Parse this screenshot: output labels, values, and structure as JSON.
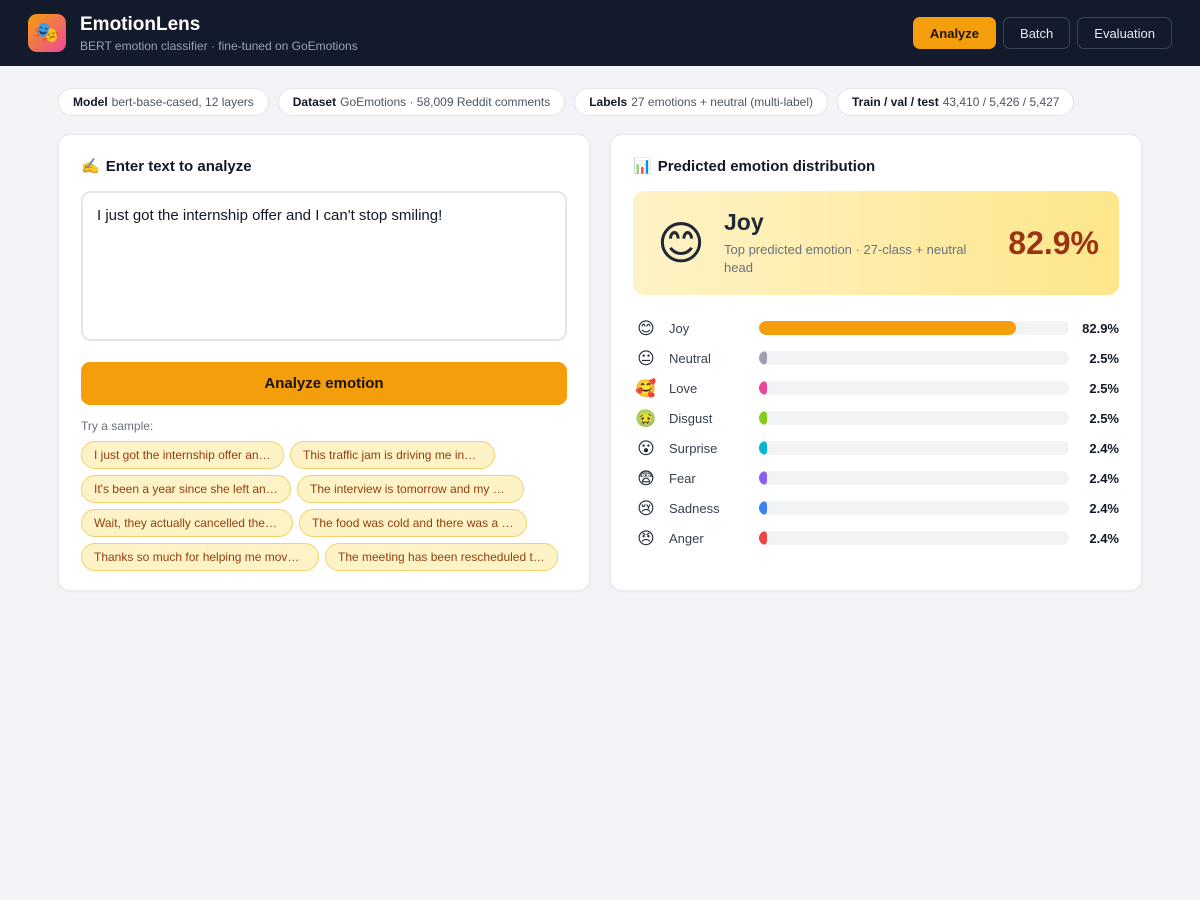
{
  "header": {
    "logo_icon": "🎭",
    "title": "EmotionLens",
    "subtitle": "BERT emotion classifier · fine-tuned on GoEmotions",
    "nav": [
      {
        "label": "Analyze",
        "active": true
      },
      {
        "label": "Batch",
        "active": false
      },
      {
        "label": "Evaluation",
        "active": false
      }
    ]
  },
  "meta": [
    {
      "key": "Model",
      "value": "bert-base-cased, 12 layers"
    },
    {
      "key": "Dataset",
      "value": "GoEmotions · 58,009 Reddit comments"
    },
    {
      "key": "Labels",
      "value": "27 emotions + neutral (multi-label)"
    },
    {
      "key": "Train / val / test",
      "value": "43,410 / 5,426 / 5,427"
    }
  ],
  "input_panel": {
    "title_icon": "✍️",
    "title": "Enter text to analyze",
    "text": "I just got the internship offer and I can't stop smiling!",
    "button_label": "Analyze emotion",
    "samples_label": "Try a sample:",
    "samples": [
      "I just got the internship offer and I can't stop smiling!",
      "This traffic jam is driving me insane!",
      "It's been a year since she left and I still miss her.",
      "The interview is tomorrow and my hands are shaking.",
      "Wait, they actually cancelled the show?!",
      "The food was cold and there was a hair in it.",
      "Thanks so much for helping me move this weekend!",
      "The meeting has been rescheduled to Thursday."
    ]
  },
  "output_panel": {
    "title_icon": "📊",
    "title": "Predicted emotion distribution",
    "top": {
      "emoji": "😊",
      "label": "Joy",
      "description": "Top predicted emotion · 27-class + neutral head",
      "percent": "82.9%"
    },
    "emotions": [
      {
        "emoji": "😊",
        "label": "Joy",
        "value": 82.9,
        "percent": "82.9%",
        "color": "#f59e0b"
      },
      {
        "emoji": "😐",
        "label": "Neutral",
        "value": 2.5,
        "percent": "2.5%",
        "color": "#9ca3af"
      },
      {
        "emoji": "🥰",
        "label": "Love",
        "value": 2.5,
        "percent": "2.5%",
        "color": "#ec4899"
      },
      {
        "emoji": "🤢",
        "label": "Disgust",
        "value": 2.5,
        "percent": "2.5%",
        "color": "#84cc16"
      },
      {
        "emoji": "😮",
        "label": "Surprise",
        "value": 2.4,
        "percent": "2.4%",
        "color": "#06b6d4"
      },
      {
        "emoji": "😨",
        "label": "Fear",
        "value": 2.4,
        "percent": "2.4%",
        "color": "#8b5cf6"
      },
      {
        "emoji": "😢",
        "label": "Sadness",
        "value": 2.4,
        "percent": "2.4%",
        "color": "#3b82f6"
      },
      {
        "emoji": "😠",
        "label": "Anger",
        "value": 2.4,
        "percent": "2.4%",
        "color": "#ef4444"
      }
    ]
  }
}
